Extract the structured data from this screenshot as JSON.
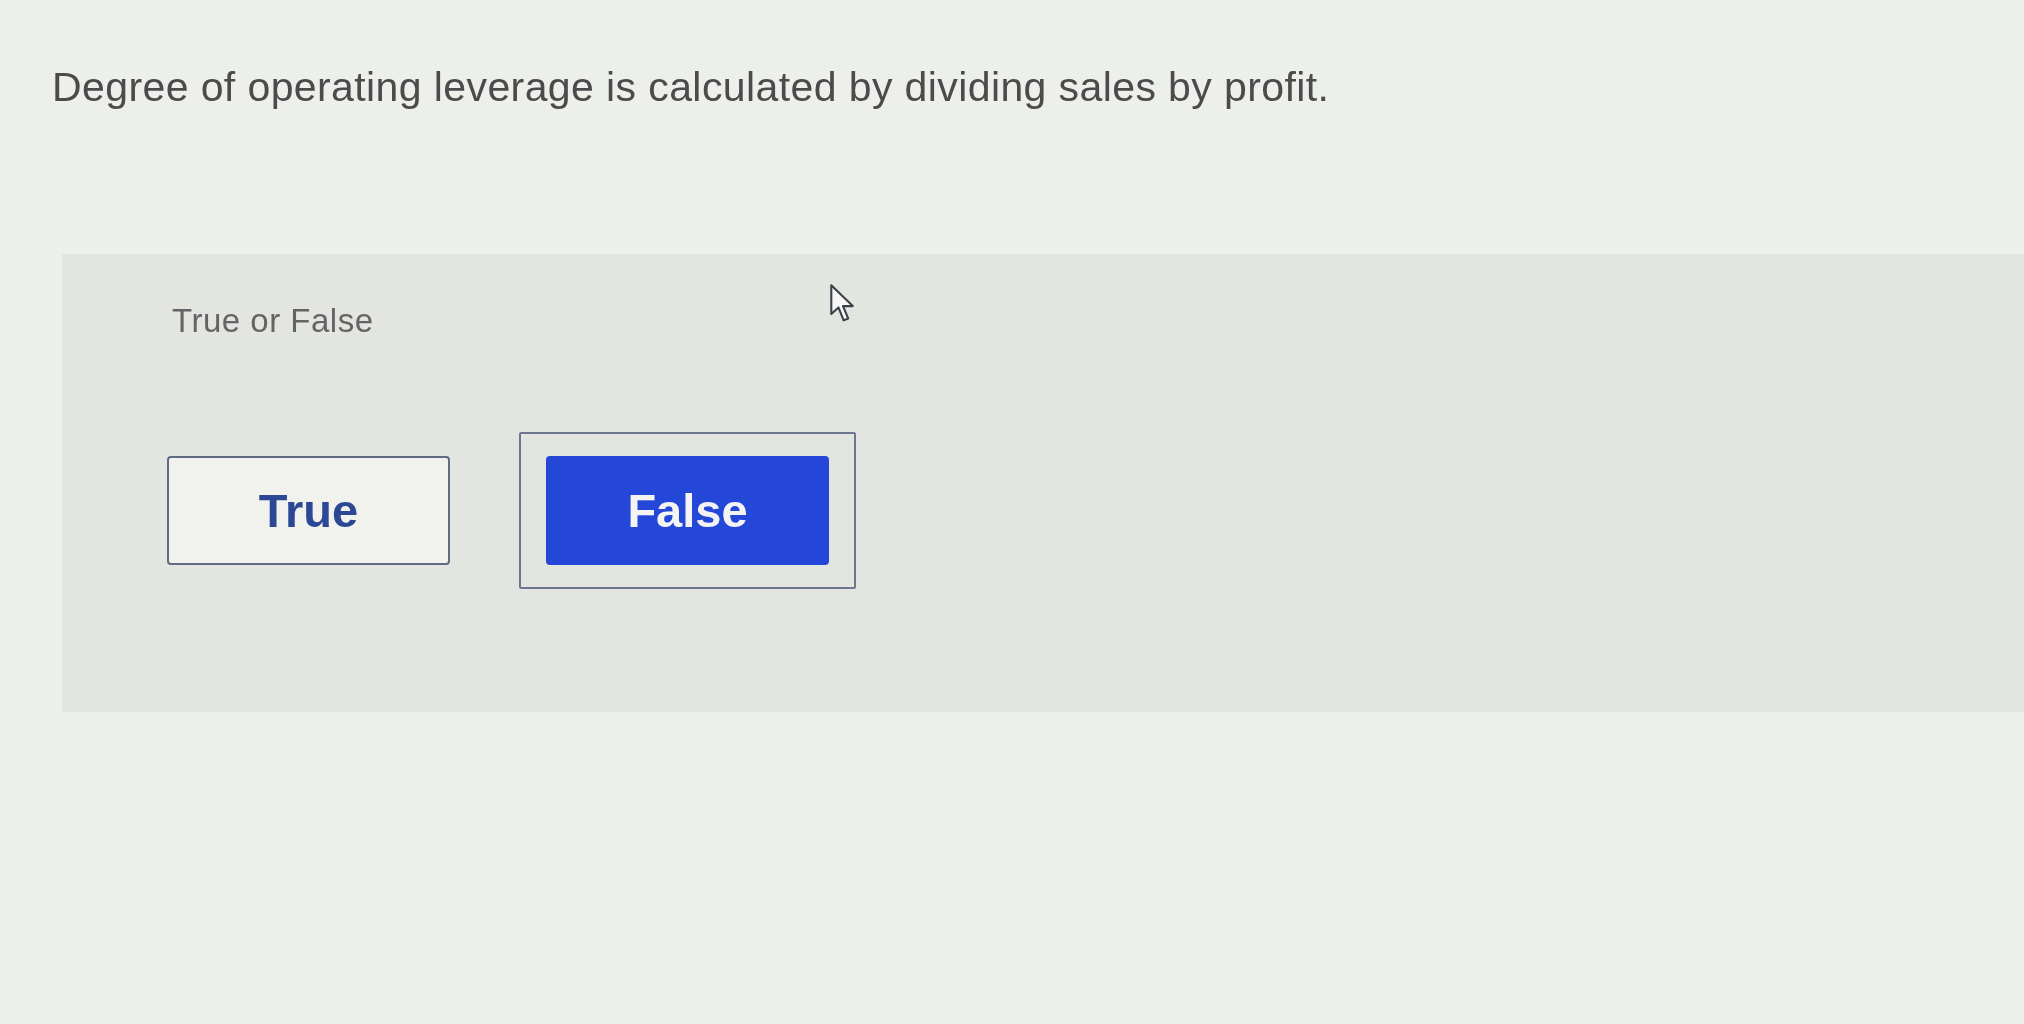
{
  "question": {
    "text": "Degree of operating leverage is calculated by dividing sales by profit."
  },
  "answer_prompt": "True or False",
  "options": [
    {
      "label": "True",
      "selected": false
    },
    {
      "label": "False",
      "selected": true
    }
  ]
}
